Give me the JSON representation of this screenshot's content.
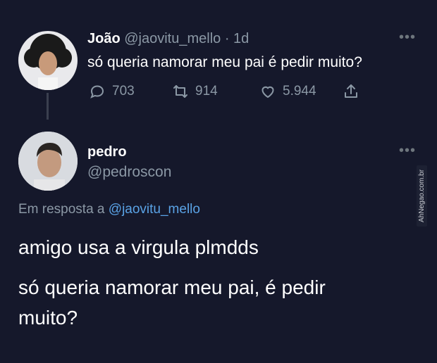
{
  "tweet1": {
    "name": "João",
    "handle": "@jaovitu_mello",
    "time": "· 1d",
    "text": "só queria namorar meu pai é pedir muito?",
    "reply_count": "703",
    "retweet_count": "914",
    "like_count": "5.944"
  },
  "tweet2": {
    "name": "pedro",
    "handle": "@pedroscon",
    "reply_prefix": "Em resposta a",
    "reply_to": "@jaovitu_mello",
    "line1": "amigo usa a virgula plmdds",
    "line2": "só queria namorar meu pai, é pedir",
    "line3": "muito?"
  },
  "more_label": "•••",
  "watermark": "AhNegao.com.br",
  "icons": {
    "reply": "reply-icon",
    "retweet": "retweet-icon",
    "like": "heart-icon",
    "share": "share-icon",
    "more": "more-icon"
  },
  "colors": {
    "background": "#15182b",
    "link": "#5aa3e6",
    "muted": "#8b98a5"
  }
}
